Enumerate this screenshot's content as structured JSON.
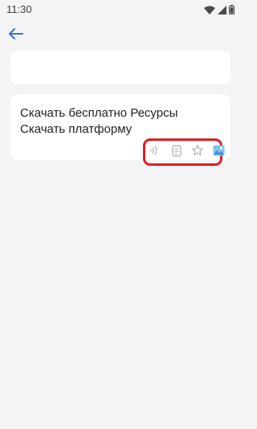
{
  "status_bar": {
    "time": "11:30",
    "icons": [
      "wifi-icon",
      "signal-icon",
      "battery-icon"
    ]
  },
  "nav": {
    "back_icon": "arrow-left-icon",
    "accent": "#3b6fd6"
  },
  "search_card": {
    "value": ""
  },
  "result_card": {
    "text": "Скачать бесплатно Ресурсы Скачать платформу",
    "actions": [
      "speaker-icon",
      "copy-icon",
      "star-icon",
      "image-icon"
    ]
  },
  "colors": {
    "background": "#f4f4f7",
    "card": "#ffffff",
    "highlight": "#e01b22",
    "icon_gray": "#b5b7bd"
  }
}
